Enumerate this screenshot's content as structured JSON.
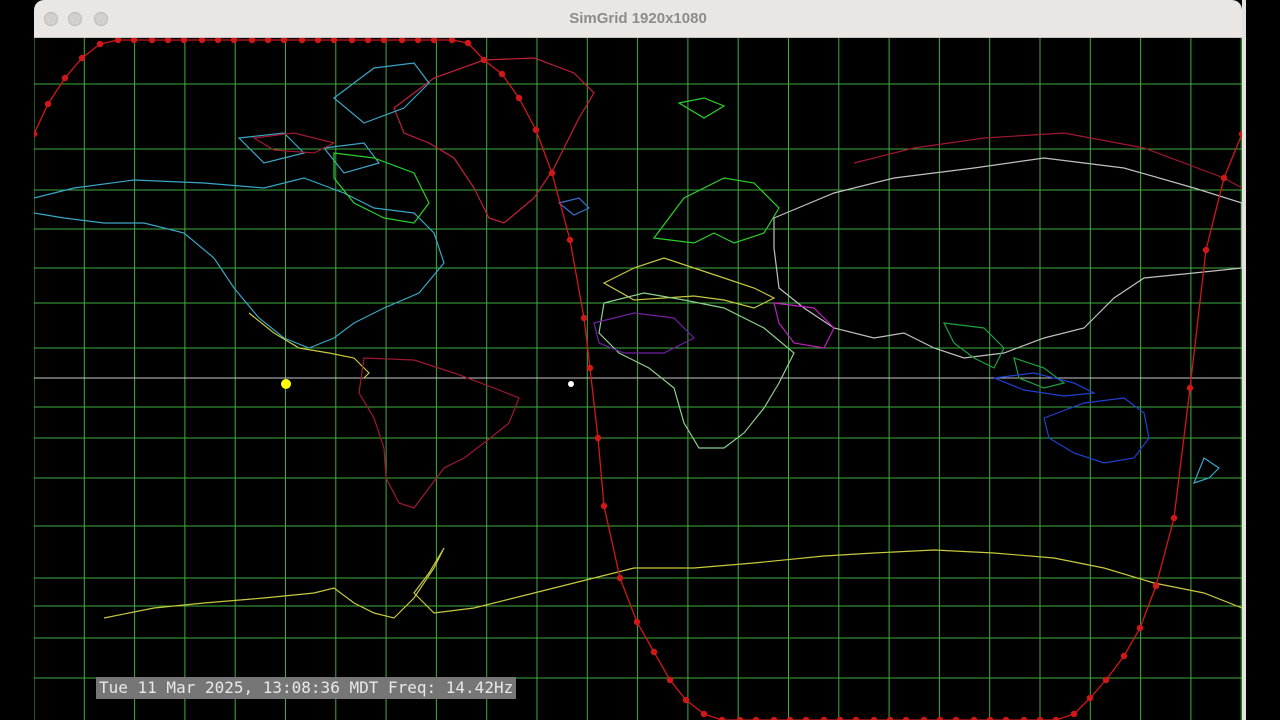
{
  "window": {
    "title": "SimGrid 1920x1080"
  },
  "status": {
    "text": "Tue 11 Mar 2025, 13:08:36 MDT Freq: 14.42Hz"
  },
  "colors": {
    "grid": "#3fae3f",
    "equator": "#c8c8c8",
    "orbit": "#d01818",
    "sun_marker": "#ffff00",
    "sat_marker": "#ffffff"
  }
}
